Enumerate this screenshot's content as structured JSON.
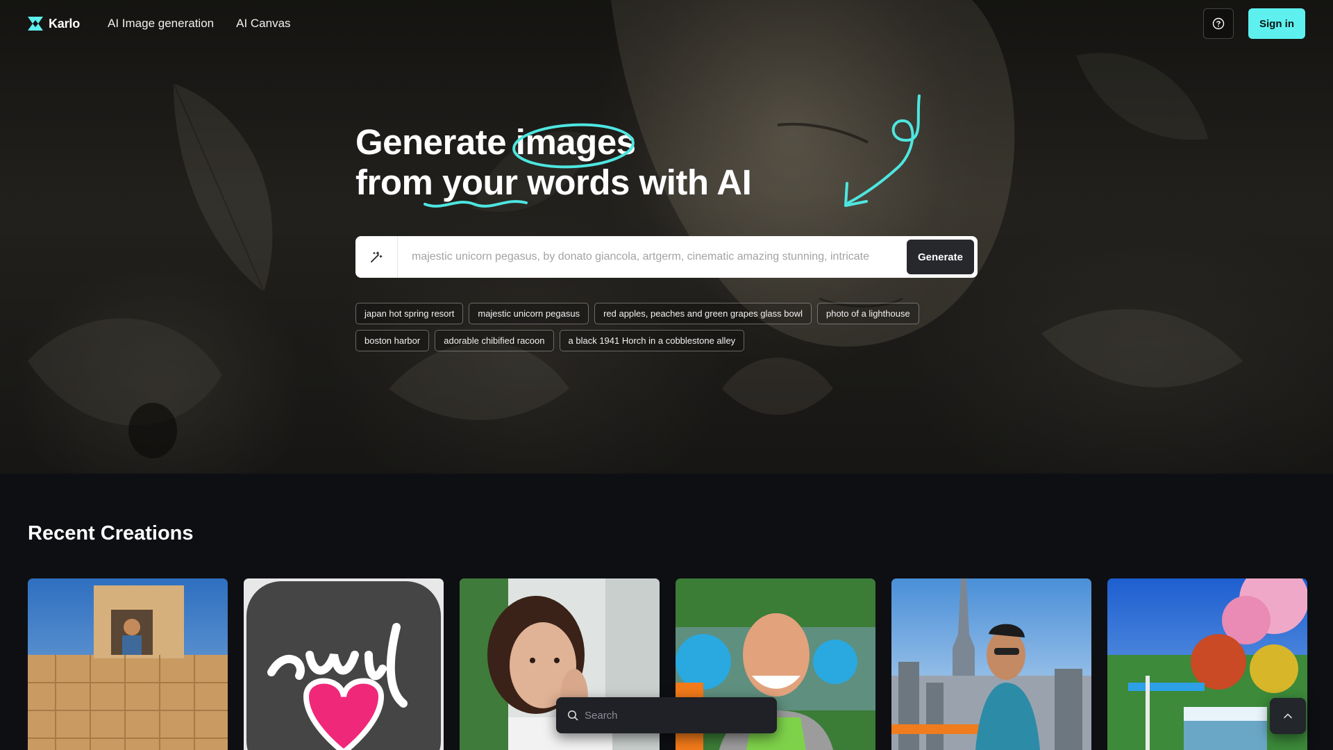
{
  "brand": {
    "name": "Karlo",
    "logo_icon": "karlo-logo-icon"
  },
  "nav": {
    "links": [
      "AI Image generation",
      "AI Canvas"
    ],
    "help_icon": "question-circle-icon",
    "signin_label": "Sign in"
  },
  "hero": {
    "headline_line1_before": "Generate ",
    "headline_line1_highlight": "images",
    "headline_line2_before": "from ",
    "headline_line2_highlight": "your",
    "headline_line2_after": " words with AI"
  },
  "prompt": {
    "icon": "magic-wand-icon",
    "placeholder": "majestic unicorn pegasus, by donato giancola, artgerm, cinematic amazing stunning, intricate",
    "value": "",
    "generate_label": "Generate"
  },
  "chips": [
    [
      "japan hot spring resort",
      "majestic unicorn pegasus",
      "red apples, peaches and green grapes glass bowl",
      "photo of a lighthouse"
    ],
    [
      "boston harbor",
      "adorable chibified racoon",
      "a black 1941 Horch in a cobblestone alley"
    ]
  ],
  "recent": {
    "title": "Recent Creations"
  },
  "floating_search": {
    "placeholder": "Search",
    "icon": "search-icon"
  },
  "scroll_top_icon": "chevron-up-icon",
  "colors": {
    "accent": "#5ef0ee",
    "background": "#0e0f13"
  }
}
